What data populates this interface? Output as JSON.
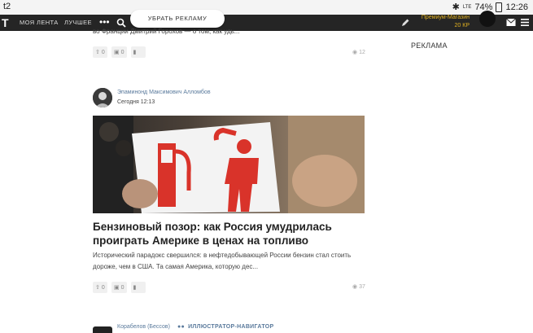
{
  "status_bar": {
    "carrier": "t2",
    "signal": "LTE",
    "battery": "74%",
    "time": "12:26"
  },
  "header": {
    "logo": "T",
    "nav": [
      "МОЯ ЛЕНТА",
      "ЛУЧШЕЕ"
    ],
    "more_icon": "more-dots-icon",
    "ad_button": "УБРАТЬ РЕКЛАМУ",
    "shop_label": "Премиум-Магазин",
    "shop_balance": "20 КР"
  },
  "prev_post": {
    "excerpt_tail": "во Франции Дмитрий Горохов — о том, как удь...",
    "likes": "0",
    "comments": "0",
    "views": "12"
  },
  "sidebar": {
    "ad_label": "РЕКЛАМА"
  },
  "post": {
    "author": "Эпаминонд Максимович Алломбов",
    "date": "Сегодня 12:13",
    "title": "Бензиновый позор: как Россия умудрилась проиграть Америке в ценах на топливо",
    "excerpt": "Исторический парадокс свершился: в нефтедобывающей России бензин стал стоить дороже, чем в США. Та самая Америка, которую дес...",
    "likes": "0",
    "comments": "0",
    "views": "37"
  },
  "next_post": {
    "author": "Корабелов (Бессов)",
    "group": "ИЛЛЮСТРАТОР-НАВИГАТОР"
  },
  "colors": {
    "header_bg": "#252525",
    "link": "#5a7a9c",
    "shop": "#e0b020",
    "sign_red": "#d9332a"
  }
}
